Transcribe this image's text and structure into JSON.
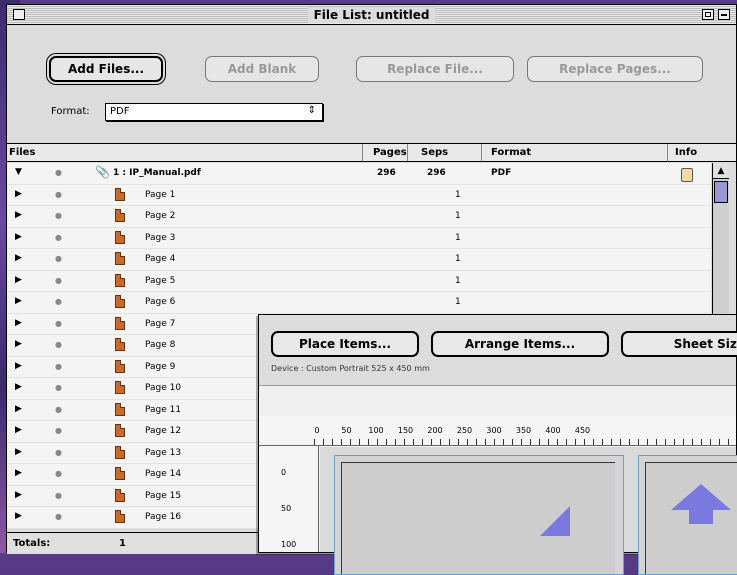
{
  "window_title": "File List: untitled",
  "toolbar": {
    "add_files": "Add Files...",
    "add_blank": "Add Blank",
    "replace_file": "Replace File...",
    "replace_pages": "Replace Pages..."
  },
  "format": {
    "label": "Format:",
    "value": "PDF"
  },
  "columns": {
    "files": "Files",
    "pages": "Pages",
    "seps": "Seps",
    "format": "Format",
    "info": "Info"
  },
  "file_row": {
    "name": "1 : IP_Manual.pdf",
    "pages": "296",
    "seps": "296",
    "format": "PDF"
  },
  "pages": [
    {
      "name": "Page 1",
      "seps": "1"
    },
    {
      "name": "Page 2",
      "seps": "1"
    },
    {
      "name": "Page 3",
      "seps": "1"
    },
    {
      "name": "Page 4",
      "seps": "1"
    },
    {
      "name": "Page 5",
      "seps": "1"
    },
    {
      "name": "Page 6",
      "seps": "1"
    },
    {
      "name": "Page 7",
      "seps": ""
    },
    {
      "name": "Page 8",
      "seps": ""
    },
    {
      "name": "Page 9",
      "seps": ""
    },
    {
      "name": "Page 10",
      "seps": ""
    },
    {
      "name": "Page 11",
      "seps": ""
    },
    {
      "name": "Page 12",
      "seps": ""
    },
    {
      "name": "Page 13",
      "seps": ""
    },
    {
      "name": "Page 14",
      "seps": ""
    },
    {
      "name": "Page 15",
      "seps": ""
    },
    {
      "name": "Page 16",
      "seps": ""
    }
  ],
  "totals": {
    "label": "Totals:",
    "value": "1"
  },
  "sheet_window": {
    "place_items": "Place Items...",
    "arrange_items": "Arrange Items...",
    "sheet_size": "Sheet Size",
    "device": "Device : Custom Portrait 525 x 450 mm",
    "h_ruler": [
      "0",
      "50",
      "100",
      "150",
      "200",
      "250",
      "300",
      "350",
      "400",
      "450"
    ],
    "v_ruler": [
      "0",
      "50",
      "100"
    ]
  }
}
